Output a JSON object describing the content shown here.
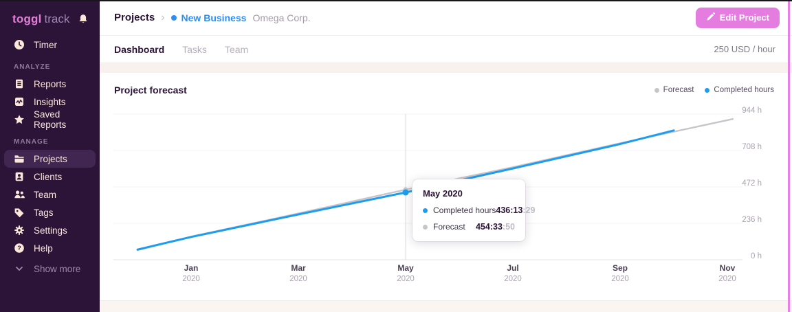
{
  "sidebar": {
    "logo_primary": "toggl",
    "logo_secondary": "track",
    "section_analyze": "ANALYZE",
    "section_manage": "MANAGE",
    "items": {
      "timer": "Timer",
      "reports": "Reports",
      "insights": "Insights",
      "saved_reports": "Saved Reports",
      "projects": "Projects",
      "clients": "Clients",
      "team": "Team",
      "tags": "Tags",
      "settings": "Settings",
      "help": "Help",
      "show_more": "Show more"
    }
  },
  "header": {
    "breadcrumb": {
      "root": "Projects",
      "separator": "›",
      "project": "New Business",
      "client": "Omega Corp."
    },
    "edit_button": "Edit Project"
  },
  "tabs": {
    "dashboard": "Dashboard",
    "tasks": "Tasks",
    "team": "Team",
    "rate": "250 USD / hour"
  },
  "chart_data": {
    "type": "line",
    "title": "Project forecast",
    "ylabel_unit": "h",
    "y_ticks": [
      0,
      236,
      472,
      708,
      944
    ],
    "ylim": [
      0,
      944
    ],
    "x_ticks": [
      {
        "label": "Jan",
        "sub": "2020",
        "m": 0
      },
      {
        "label": "Mar",
        "sub": "2020",
        "m": 2
      },
      {
        "label": "May",
        "sub": "2020",
        "m": 4
      },
      {
        "label": "Jul",
        "sub": "2020",
        "m": 6
      },
      {
        "label": "Sep",
        "sub": "2020",
        "m": 8
      },
      {
        "label": "Nov",
        "sub": "2020",
        "m": 10
      }
    ],
    "series": [
      {
        "name": "Forecast",
        "color": "#c7c5c9",
        "points": [
          [
            -1,
            62
          ],
          [
            0,
            150
          ],
          [
            2,
            300
          ],
          [
            4,
            454.56
          ],
          [
            6,
            600
          ],
          [
            8,
            755
          ],
          [
            10.1,
            912
          ]
        ]
      },
      {
        "name": "Completed hours",
        "color": "#1e9df0",
        "points": [
          [
            -1,
            66
          ],
          [
            0,
            148
          ],
          [
            2,
            294
          ],
          [
            4,
            436.22
          ],
          [
            6,
            592
          ],
          [
            8,
            750
          ],
          [
            9,
            838
          ]
        ]
      }
    ],
    "legend": [
      {
        "label": "Forecast",
        "color": "#c7c5c9"
      },
      {
        "label": "Completed hours",
        "color": "#1e9df0"
      }
    ],
    "hover": {
      "m": 4,
      "tooltip": {
        "title": "May 2020",
        "rows": [
          {
            "label": "Completed hours",
            "value": "436:13",
            "seconds": ":29",
            "color": "#1e9df0"
          },
          {
            "label": "Forecast",
            "value": "454:33",
            "seconds": ":50",
            "color": "#c7c5c9"
          }
        ]
      }
    }
  }
}
